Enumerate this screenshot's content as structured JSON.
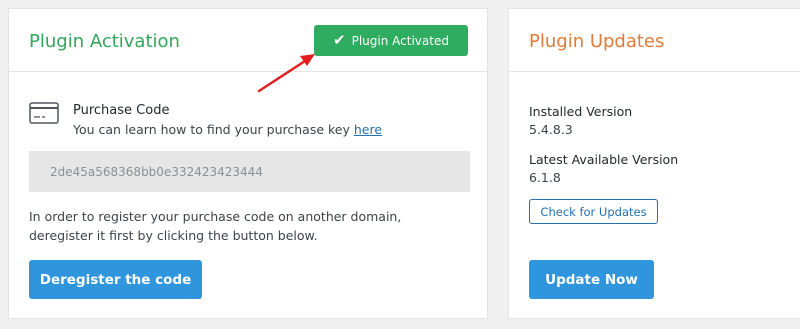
{
  "activation": {
    "title": "Plugin Activation",
    "badge_label": "Plugin Activated",
    "purchase_code_label": "Purchase Code",
    "help_text": "You can learn how to find your purchase key ",
    "help_link": "here",
    "purchase_code_value": "2de45a568368bb0e332423423444",
    "deregister_note": "In order to register your purchase code on another domain, deregister it first by clicking the button below.",
    "deregister_button": "Deregister the code"
  },
  "updates": {
    "title": "Plugin Updates",
    "installed_label": "Installed Version",
    "installed_value": "5.4.8.3",
    "latest_label": "Latest Available Version",
    "latest_value": "6.1.8",
    "check_button": "Check for Updates",
    "update_button": "Update Now"
  },
  "icons": {
    "badge_check": "✔",
    "card": "credit-card-icon",
    "arrow": "red-arrow-annotation"
  },
  "colors": {
    "activation_title": "#2fa65a",
    "updates_title": "#e07b39",
    "badge_bg": "#2eac5f",
    "primary_button": "#2f96dd",
    "link": "#2271b1",
    "arrow": "#e11d1d"
  }
}
